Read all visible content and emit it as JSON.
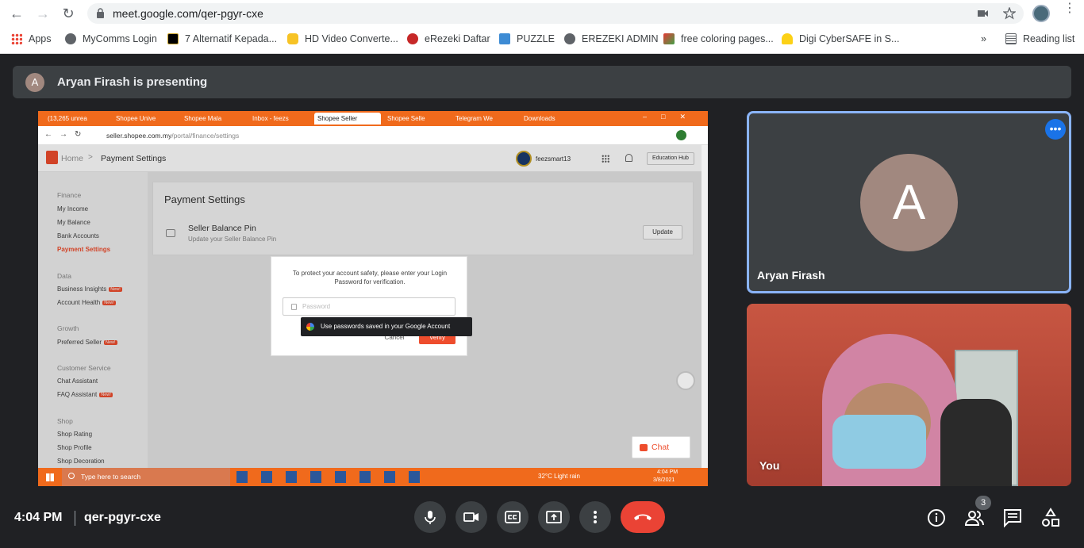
{
  "browser": {
    "url": "meet.google.com/qer-pgyr-cxe",
    "bookmarks": [
      {
        "label": "Apps"
      },
      {
        "label": "MyComms Login"
      },
      {
        "label": "7 Alternatif Kepada..."
      },
      {
        "label": "HD Video Converte..."
      },
      {
        "label": "eRezeki Daftar"
      },
      {
        "label": "PUZZLE"
      },
      {
        "label": "EREZEKI ADMIN"
      },
      {
        "label": "free coloring pages..."
      },
      {
        "label": "Digi CyberSAFE in S..."
      }
    ],
    "overflow": "»",
    "reading_list": "Reading list"
  },
  "meet": {
    "presenting_initial": "A",
    "presenting_text": "Aryan Firash is presenting",
    "participant": {
      "initial": "A",
      "name": "Aryan Firash"
    },
    "self_name": "You",
    "clock": "4:04 PM",
    "meeting_code": "qer-pgyr-cxe",
    "people_count": "3"
  },
  "shared": {
    "tabs": [
      "(13,265 unrea",
      "Shopee Unive",
      "Shopee Mala",
      "Inbox - feezs",
      "Shopee Seller",
      "Shopee Selle",
      "Telegram We",
      "Downloads"
    ],
    "url_domain": "seller.shopee.com.my",
    "url_path": "/portal/finance/settings",
    "breadcrumb_home": "Home",
    "breadcrumb_current": "Payment Settings",
    "username": "feezsmart13",
    "education_hub": "Education Hub",
    "sidebar": [
      {
        "section": "Finance",
        "items": [
          "My Income",
          "My Balance",
          "Bank Accounts",
          "Payment Settings"
        ]
      },
      {
        "section": "Data",
        "items": [
          "Business Insights",
          "Account Health"
        ]
      },
      {
        "section": "Growth",
        "items": [
          "Preferred Seller"
        ]
      },
      {
        "section": "Customer Service",
        "items": [
          "Chat Assistant",
          "FAQ Assistant"
        ]
      },
      {
        "section": "Shop",
        "items": [
          "Shop Rating",
          "Shop Profile",
          "Shop Decoration"
        ]
      }
    ],
    "new_badge": "New!",
    "page_title": "Payment Settings",
    "pin_title": "Seller Balance Pin",
    "pin_desc": "Update your Seller Balance Pin",
    "update_btn": "Update",
    "modal_text": "To protect your account safety, please enter your Login Password for verification.",
    "password_placeholder": "Password",
    "cancel_btn": "Cancel",
    "verify_btn": "Verify",
    "tooltip": "Use passwords saved in your Google Account",
    "chat_label": "Chat",
    "search_placeholder": "Type here to search",
    "weather": "32°C  Light rain",
    "tb_time": "4:04 PM",
    "tb_date": "3/8/2021"
  }
}
